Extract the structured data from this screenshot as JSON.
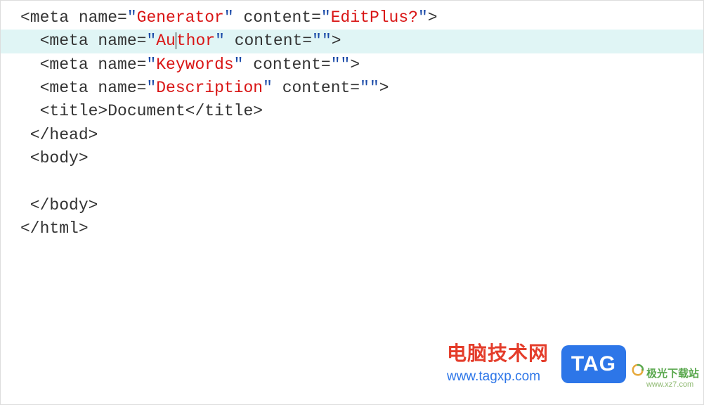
{
  "code": {
    "line1": {
      "prefix": "<meta name=",
      "q": "\"",
      "val1": "Generator",
      "mid": " content=",
      "val2": "EditPlus?",
      "suffix": ">"
    },
    "line2": {
      "prefix": "  <meta name=",
      "q": "\"",
      "val1a": "Au",
      "val1b": "thor",
      "mid": " content=",
      "val2": "",
      "suffix": ">"
    },
    "line3": {
      "prefix": "  <meta name=",
      "q": "\"",
      "val1": "Keywords",
      "mid": " content=",
      "val2": "",
      "suffix": ">"
    },
    "line4": {
      "prefix": "  <meta name=",
      "q": "\"",
      "val1": "Description",
      "mid": " content=",
      "val2": "",
      "suffix": ">"
    },
    "line5": "  <title>Document</title>",
    "line6": " </head>",
    "line7": " <body>",
    "line8": "  ",
    "line9": " </body>",
    "line10": "</html>"
  },
  "watermark": {
    "title": "电脑技术网",
    "url": "www.tagxp.com",
    "badge": "TAG"
  },
  "watermark2": {
    "cn": "极光下载站",
    "url": "www.xz7.com"
  }
}
